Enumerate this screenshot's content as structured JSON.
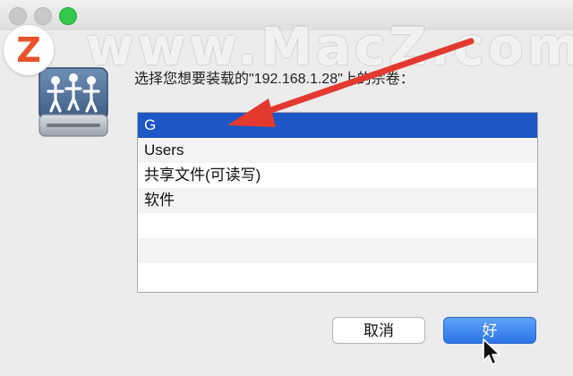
{
  "dialog": {
    "prompt": "选择您想要装载的\"192.168.1.28\"上的宗卷：",
    "volumes": [
      "G",
      "Users",
      "共享文件(可读写)",
      "软件"
    ],
    "selected_index": 0,
    "empty_rows": 3,
    "cancel_label": "取消",
    "ok_label": "好"
  },
  "watermark": {
    "logo_letter": "Z",
    "text": "www.MacZ.com"
  },
  "icons": {
    "share": "network-share-icon",
    "arrow": "annotation-arrow-icon",
    "cursor": "mouse-pointer-icon"
  },
  "colors": {
    "selection": "#1c56c7",
    "ok_button": "#2a74e8",
    "arrow": "#e23a2e",
    "logo": "#e8532b",
    "zoom_light": "#34c84a"
  }
}
